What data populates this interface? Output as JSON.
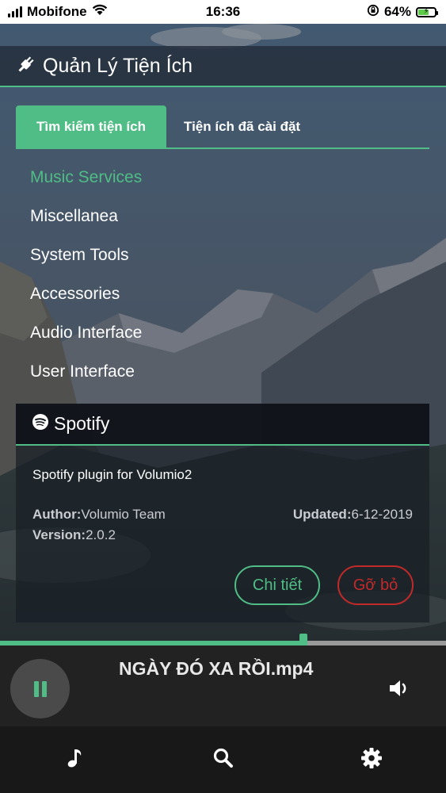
{
  "status_bar": {
    "carrier": "Mobifone",
    "time": "16:36",
    "battery_percent": "64%",
    "battery_level": 0.64,
    "icons": [
      "signal-icon",
      "wifi-icon",
      "orientation-lock-icon",
      "battery-icon"
    ]
  },
  "header": {
    "icon": "plug-icon",
    "title": "Quản Lý Tiện Ích"
  },
  "tabs": [
    {
      "label": "Tìm kiếm tiện ích",
      "active": true
    },
    {
      "label": "Tiện ích đã cài đặt",
      "active": false
    }
  ],
  "categories": [
    {
      "label": "Music Services",
      "active": true
    },
    {
      "label": "Miscellanea",
      "active": false
    },
    {
      "label": "System Tools",
      "active": false
    },
    {
      "label": "Accessories",
      "active": false
    },
    {
      "label": "Audio Interface",
      "active": false
    },
    {
      "label": "User Interface",
      "active": false
    }
  ],
  "plugin": {
    "icon": "spotify-icon",
    "name": "Spotify",
    "description": "Spotify plugin for Volumio2",
    "author_label": "Author:",
    "author": "Volumio Team",
    "version_label": "Version:",
    "version": "2.0.2",
    "updated_label": "Updated:",
    "updated": "6-12-2019",
    "details_button": "Chi tiết",
    "remove_button": "Gỡ bỏ"
  },
  "player": {
    "track_title": "NGÀY ĐÓ XA RỒI.mp4",
    "progress": 0.68,
    "state": "playing",
    "icons": [
      "pause-icon",
      "volume-icon"
    ]
  },
  "bottom_nav": [
    {
      "icon": "music-note-icon"
    },
    {
      "icon": "search-icon"
    },
    {
      "icon": "gear-icon"
    }
  ],
  "colors": {
    "accent": "#4fbd85",
    "danger": "#c22a2a",
    "player_bg": "#222222",
    "nav_bg": "#181818"
  }
}
